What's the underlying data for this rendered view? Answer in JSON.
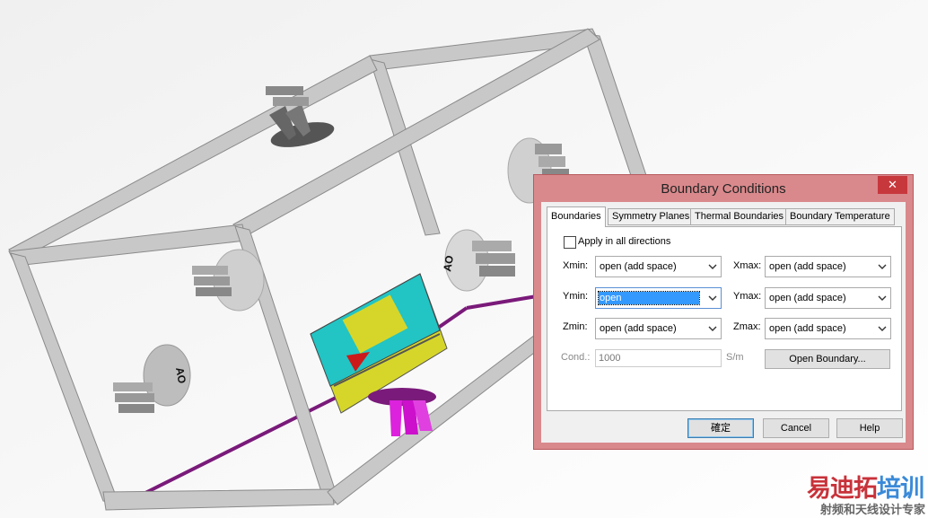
{
  "dialog": {
    "title": "Boundary Conditions",
    "close_glyph": "✕",
    "tabs": [
      {
        "label": "Boundaries",
        "active": true
      },
      {
        "label": "Symmetry Planes",
        "active": false
      },
      {
        "label": "Thermal Boundaries",
        "active": false
      },
      {
        "label": "Boundary Temperature",
        "active": false
      }
    ],
    "apply_all": {
      "label": "Apply in all directions",
      "checked": false
    },
    "fields": {
      "xmin": {
        "label": "Xmin:",
        "value": "open (add space)"
      },
      "xmax": {
        "label": "Xmax:",
        "value": "open (add space)"
      },
      "ymin": {
        "label": "Ymin:",
        "value": "open"
      },
      "ymax": {
        "label": "Ymax:",
        "value": "open (add space)"
      },
      "zmin": {
        "label": "Zmin:",
        "value": "open (add space)"
      },
      "zmax": {
        "label": "Zmax:",
        "value": "open (add space)"
      }
    },
    "cond": {
      "label": "Cond.:",
      "value": "1000",
      "unit": "S/m"
    },
    "open_boundary_button": "Open Boundary...",
    "ok_button": "確定",
    "cancel_button": "Cancel",
    "help_button": "Help"
  },
  "watermark": {
    "brand_part1": "易迪拓",
    "brand_part2": "培训",
    "subtitle": "射频和天线设计专家",
    "color1": "#c8323a",
    "color2": "#3a8ad8"
  },
  "viewport": {
    "background": "#f3f3f3",
    "frame_color": "#c2c2c2",
    "antenna_label": "AO"
  }
}
